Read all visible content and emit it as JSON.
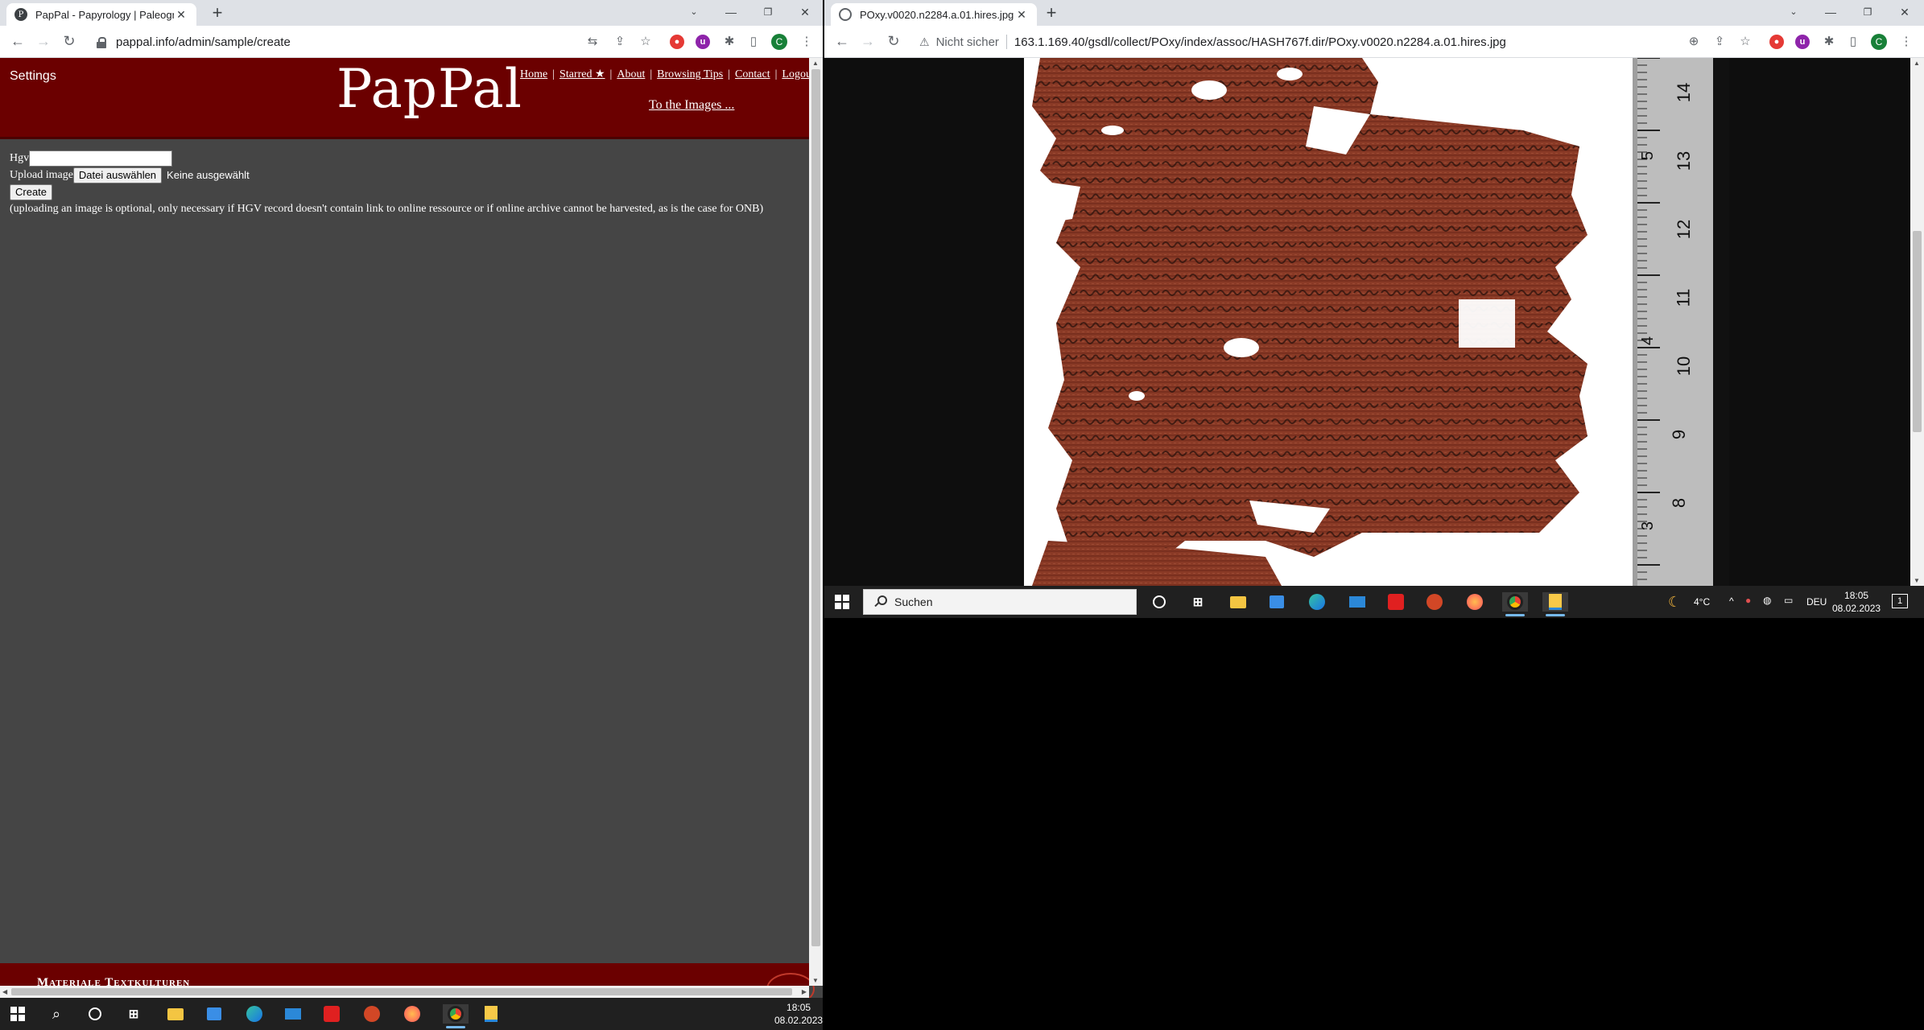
{
  "left_window": {
    "tab_title": "PapPal - Papyrology | Paleograph",
    "url": "pappal.info/admin/sample/create",
    "site": {
      "settings": "Settings",
      "logo": "PapPal",
      "menu": [
        "Home",
        "Starred ★",
        "About",
        "Browsing Tips",
        "Contact",
        "Logout"
      ],
      "menu_separator": "|",
      "to_images": "To the Images ...",
      "form": {
        "hgv_label": "Hgv",
        "hgv_value": "",
        "upload_label": "Upload image",
        "file_button": "Datei auswählen",
        "file_status": "Keine ausgewählt",
        "create_button": "Create",
        "note": "(uploading an image is optional, only necessary if HGV record doesn't contain link to online ressource or if online archive cannot be harvested, as is the case for ONB)"
      },
      "footer": "Materiale Textkulturen"
    },
    "profile_initial": "C",
    "taskbar": {
      "time": "18:05",
      "date": "08.02.2023"
    }
  },
  "right_window": {
    "tab_title": "POxy.v0020.n2284.a.01.hires.jpg",
    "security_label": "Nicht sicher",
    "url": "163.1.169.40/gsdl/collect/POxy/index/assoc/HASH767f.dir/POxy.v0020.n2284.a.01.hires.jpg",
    "ruler_cm": [
      "14",
      "13",
      "12",
      "11",
      "10",
      "9",
      "8"
    ],
    "ruler_inch": [
      "5",
      "4",
      "3"
    ],
    "profile_initial": "C",
    "taskbar": {
      "search_placeholder": "Suchen",
      "temperature": "4°C",
      "language": "DEU",
      "time": "18:05",
      "date": "08.02.2023",
      "notification_count": "1"
    }
  },
  "colors": {
    "pappal_red": "#6b0000",
    "page_bg": "#454545",
    "papyrus": "#8a3a26"
  }
}
